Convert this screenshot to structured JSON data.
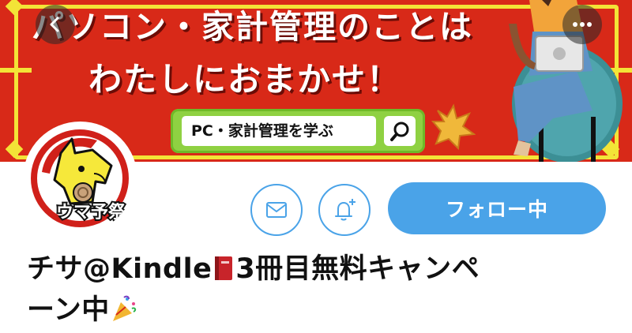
{
  "banner": {
    "title_line1": "パソコン・家計管理のことは",
    "title_line2": "わたしにおまかせ！",
    "search_label": "PC・家計管理を学ぶ"
  },
  "avatar": {
    "label": "ウマ予祭"
  },
  "actions": {
    "follow_label": "フォロー中"
  },
  "profile": {
    "name_part1": "チサ@Kindle",
    "name_part2": "3冊目無料キャンペ",
    "name_part3": "ーン中"
  },
  "colors": {
    "accent": "#4aa3e8",
    "banner_red": "#d82918",
    "banner_yellow": "#f3e437",
    "search_green": "#8fd142"
  },
  "icons": [
    "back-icon",
    "more-icon",
    "search-icon",
    "mail-icon",
    "bell-plus-icon",
    "book-emoji",
    "party-popper-emoji"
  ]
}
